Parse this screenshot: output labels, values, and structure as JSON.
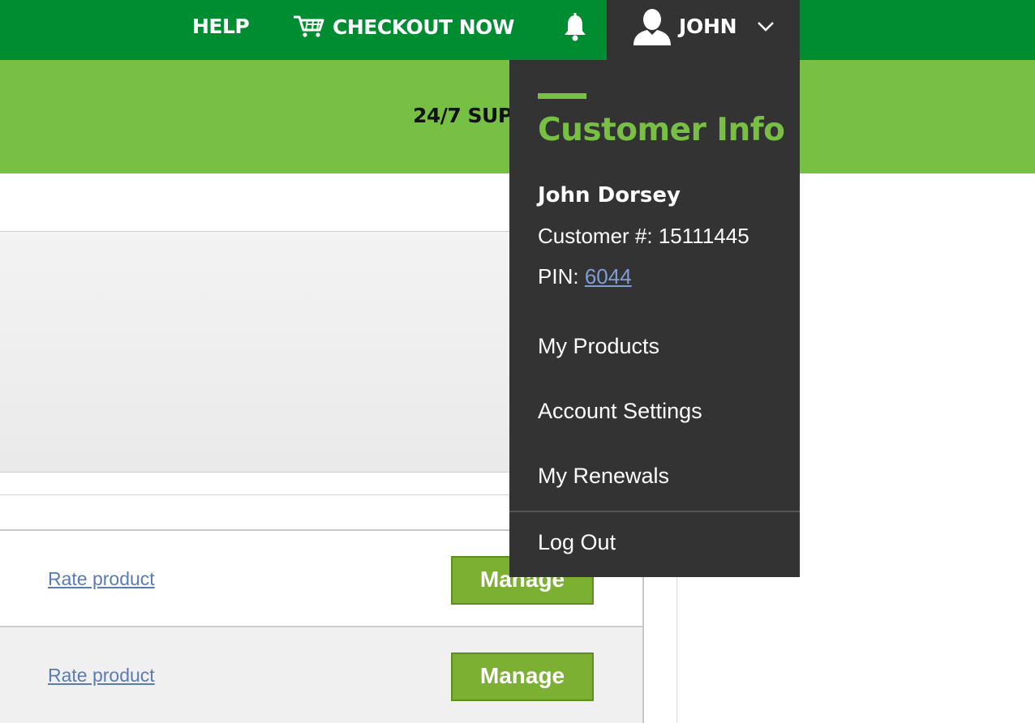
{
  "topnav": {
    "help_label": "HELP",
    "checkout_label": "CHECKOUT NOW",
    "bell_icon": "bell-icon",
    "cart_icon": "cart-icon",
    "user_icon": "user-icon",
    "user_label": "JOHN"
  },
  "banner": {
    "text": "24/7 SUP"
  },
  "products": {
    "rows": [
      {
        "rate_label": "Rate product",
        "manage_label": "Manage"
      },
      {
        "rate_label": "Rate product",
        "manage_label": "Manage"
      }
    ]
  },
  "dropdown": {
    "title": "Customer Info",
    "customer_name": "John Dorsey",
    "customer_number_label": "Customer #:",
    "customer_number": "15111445",
    "pin_label": "PIN:",
    "pin_value": "6044",
    "menu": [
      {
        "label": "My Products"
      },
      {
        "label": "Account Settings"
      },
      {
        "label": "My Renewals"
      }
    ],
    "logout_label": "Log Out"
  },
  "colors": {
    "topbar": "#008d32",
    "banner": "#77c044",
    "dropdown_bg": "#333333",
    "accent_green": "#77c044",
    "manage_button": "#7bb032",
    "link": "#5b7bb5"
  }
}
